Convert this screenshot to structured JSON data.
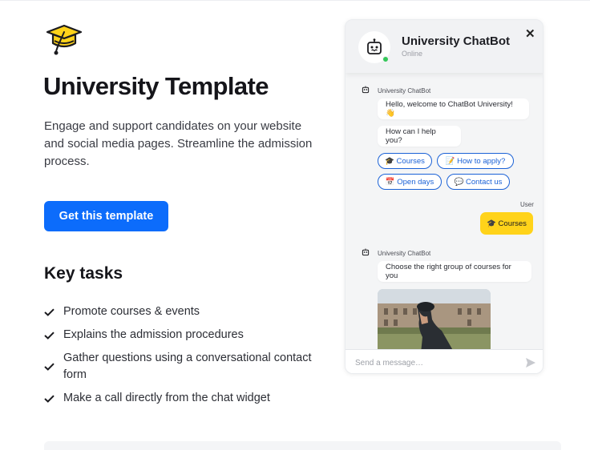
{
  "page": {
    "title": "University Template",
    "description": "Engage and support candidates on your website and social media pages. Streamline the admission process.",
    "cta_label": "Get this template",
    "key_tasks_title": "Key tasks",
    "tasks": [
      "Promote courses & events",
      "Explains the admission procedures",
      "Gather questions using a conversational contact form",
      "Make a call directly from the chat widget"
    ],
    "accent_color": "#0c6cfb"
  },
  "icons": {
    "logo": "graduation-cap-icon",
    "check": "checkmark-icon",
    "bot": "robot-icon",
    "close": "close-icon",
    "send": "send-icon"
  },
  "chat": {
    "bot_name": "University ChatBot",
    "status": "Online",
    "close_glyph": "✕",
    "sender_name_1": "University ChatBot",
    "greeting": "Hello, welcome to ChatBot University! 👋",
    "question": "How can I help you?",
    "quick_replies": [
      "🎓 Courses",
      "📝 How to apply?",
      "📅 Open days",
      "💬 Contact us"
    ],
    "user_label": "User",
    "user_message": "🎓 Courses",
    "sender_name_2": "University ChatBot",
    "bot_reply": "Choose the right group of courses for you",
    "input_placeholder": "Send a message…",
    "user_bubble_color": "#ffd31a",
    "quick_reply_color": "#1a61d6"
  }
}
